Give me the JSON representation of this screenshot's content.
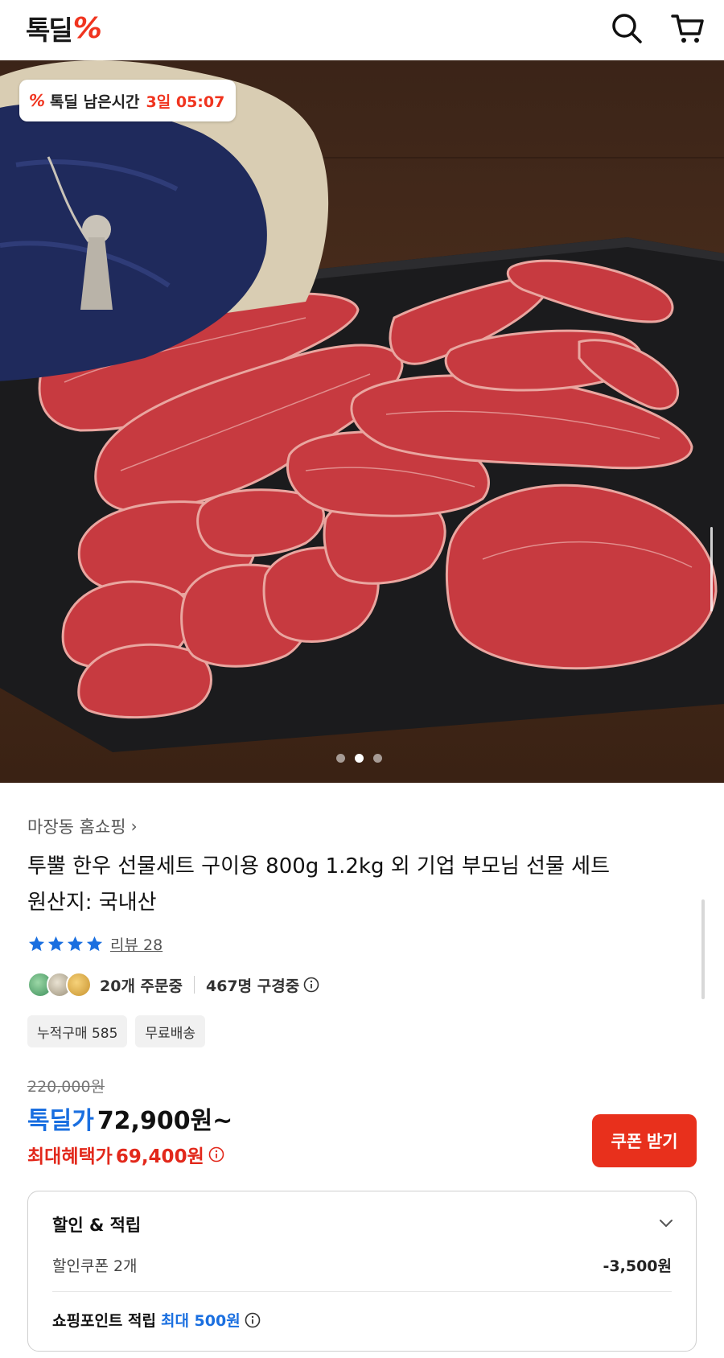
{
  "header": {
    "logo_text": "톡딜",
    "logo_pct": "%",
    "search_icon": "search-icon",
    "cart_icon": "cart-icon"
  },
  "hero": {
    "timer_badge": {
      "icon_text": "%",
      "label": "톡딜 남은시간",
      "value": "3일 05:07"
    },
    "carousel": {
      "total": 3,
      "active_index": 1
    },
    "colors": {
      "wood": "#4a2d1c",
      "slate": "#1c1c1e",
      "bojagi_navy": "#1f2a5c",
      "meat": "#c0323a"
    }
  },
  "product": {
    "seller": "마장동 홈쇼핑",
    "title_line1": "투뿔 한우 선물세트 구이용 800g 1.2kg 외 기업 부모님 선물 세트",
    "title_line2": "원산지: 국내산",
    "rating": {
      "stars": 4,
      "review_text": "리뷰 28"
    },
    "buyers": {
      "ordering": "20개 주문중",
      "viewing": "467명 구경중"
    },
    "tags": [
      "누적구매 585",
      "무료배송"
    ]
  },
  "price": {
    "original": "220,000원",
    "deal_label": "톡딜가",
    "deal_price": "72,900원~",
    "max_label": "최대혜택가",
    "max_price": "69,400원",
    "coupon_button": "쿠폰 받기"
  },
  "discount_panel": {
    "title": "할인 & 적립",
    "coupon_label": "할인쿠폰 2개",
    "coupon_value": "-3,500원",
    "points_label": "쇼핑포인트 적립",
    "points_value": "최대 500원"
  },
  "colors": {
    "accent_red": "#e8301c",
    "deal_blue": "#1a6fe0",
    "star_blue": "#1a6fe0"
  }
}
